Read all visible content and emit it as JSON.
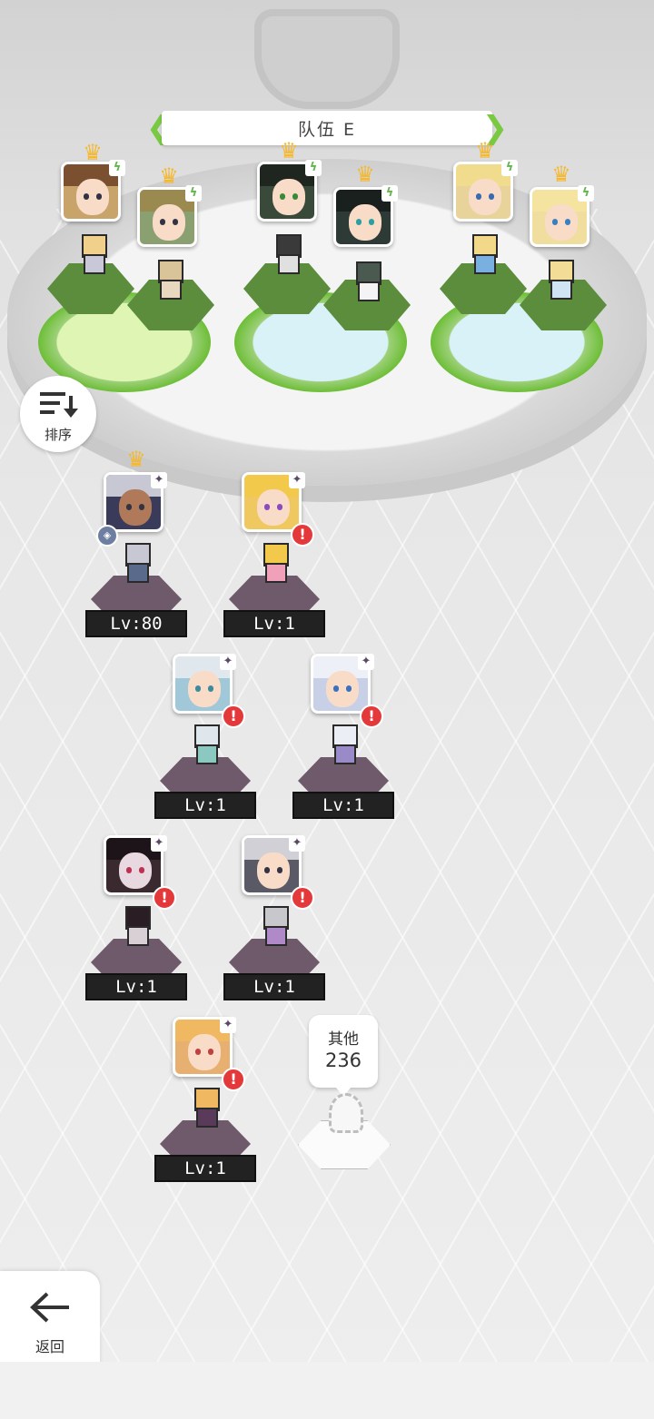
{
  "team": {
    "name": "队伍 E"
  },
  "sort": {
    "label": "排序"
  },
  "roster": [
    {
      "level": "Lv:80"
    },
    {
      "level": "Lv:1"
    },
    {
      "level": "Lv:1"
    },
    {
      "level": "Lv:1"
    },
    {
      "level": "Lv:1"
    },
    {
      "level": "Lv:1"
    },
    {
      "level": "Lv:1"
    }
  ],
  "other": {
    "label": "其他",
    "count": "236"
  },
  "back": {
    "label": "返回"
  },
  "icons": {
    "crown": "crown-icon",
    "warning": "warning-icon",
    "element_wind": "wind-element-icon",
    "element_dark": "dark-element-icon"
  },
  "colors": {
    "accent_green": "#7ac943",
    "warning_red": "#e3393a",
    "crown_gold": "#f5b82e"
  }
}
